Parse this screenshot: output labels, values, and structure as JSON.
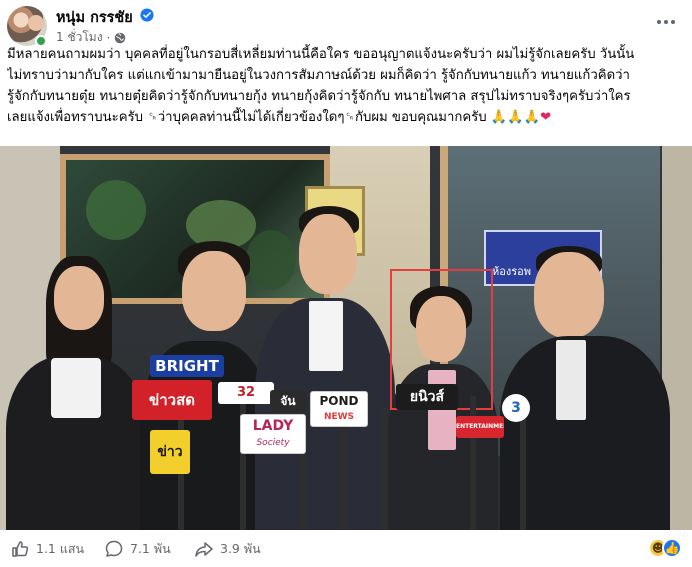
{
  "header": {
    "author_name": "หนุ่ม กรรชัย",
    "timestamp": "1 ชั่วโมง",
    "separator": "·"
  },
  "caption": {
    "lines": [
      "มีหลายคนถามผมว่า บุคคลที่อยู่ในกรอบสี่เหลี่ยมท่านนี้คือใคร ขออนุญาตแจ้งนะครับว่า ผมไม่รู้จักเลยครับ วันนั้น",
      "ไม่ทราบว่ามากับใคร แต่แกเข้ามามายืนอยู่ในวงการสัมภาษณ์ด้วย ผมก็คิดว่า รู้จักกับทนายแก้ว ทนายแก้วคิดว่า",
      "รู้จักกับทนายตุ๋ย ทนายตุ๋ยคิดว่ารู้จักกับทนายกุ้ง ทนายกุ้งคิดว่ารู้จักกับ ทนายไพศาล สรุปไม่ทราบจริงๆครับว่าใคร",
      "เลยแจ้งเพื่อทราบนะครับ ␍ว่าบุคคลท่านนี้ไม่ได้เกี่ยวข้องใดๆ␍กับผม ขอบคุณมากครับ"
    ],
    "emoji_tail": [
      "🙏",
      "🙏",
      "🙏",
      "❤"
    ]
  },
  "photo": {
    "sign_text": "ห้องรอพ",
    "mic_labels": {
      "bright": "BRIGHT",
      "tv32": "32",
      "red_left": "ข่าวสด",
      "khao": "ข่าว",
      "lady": "LADY",
      "lady_sub": "Society",
      "pond": "POND",
      "pond_sub": "NEWS",
      "younews": "ยนิวส์",
      "ch3_top": "3",
      "ent": "ENTERTAINMENT",
      "chan": "จัน"
    }
  },
  "footer": {
    "likes": "1.1 แสน",
    "comments": "7.1 พัน",
    "shares": "3.9 พัน"
  },
  "colors": {
    "verified": "#1877f2",
    "online": "#31a24c",
    "highlight": "#e43f3f",
    "secondary_text": "#65676b"
  }
}
